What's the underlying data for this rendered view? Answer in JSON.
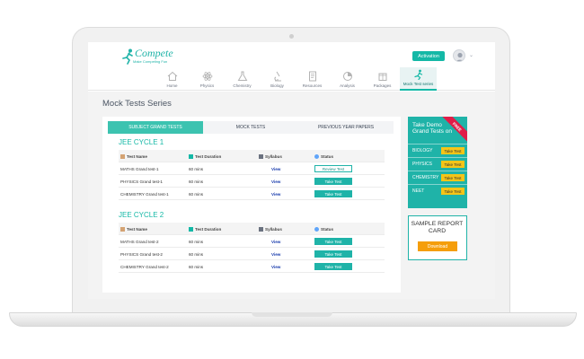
{
  "brand": {
    "logo_text": "Compete",
    "tagline": "Make Competing Fun",
    "accent": "#1fb3a8"
  },
  "header": {
    "activation_label": "Activation"
  },
  "nav": [
    {
      "label": "Home",
      "icon": "home-icon"
    },
    {
      "label": "Physics",
      "icon": "atom-icon"
    },
    {
      "label": "Chemistry",
      "icon": "flask-icon"
    },
    {
      "label": "Biology",
      "icon": "microscope-icon"
    },
    {
      "label": "Resources",
      "icon": "book-icon"
    },
    {
      "label": "Analysis",
      "icon": "pie-chart-icon"
    },
    {
      "label": "Packages",
      "icon": "box-icon"
    },
    {
      "label": "Mock Test series",
      "icon": "runner-icon",
      "active": true
    }
  ],
  "page": {
    "title": "Mock Tests Series"
  },
  "tabs": [
    {
      "label": "SUBJECT GRAND TESTS",
      "active": true
    },
    {
      "label": "MOCK TESTS"
    },
    {
      "label": "PREVIOUS YEAR PAPERS"
    }
  ],
  "columns": [
    "Test Name",
    "Test Duration",
    "Syllabus",
    "Status"
  ],
  "cycles": [
    {
      "title": "JEE CYCLE 1",
      "rows": [
        {
          "name": "MATHS Grand test-1",
          "duration": "60 mins",
          "syllabus": "View",
          "status": "Review Test"
        },
        {
          "name": "PHYSICS Grand test-1",
          "duration": "60 mins",
          "syllabus": "View",
          "status": "Take Test"
        },
        {
          "name": "CHEMISTRY Grand test-1",
          "duration": "60 mins",
          "syllabus": "View",
          "status": "Take Test"
        }
      ]
    },
    {
      "title": "JEE CYCLE 2",
      "rows": [
        {
          "name": "MATHS Grand test-2",
          "duration": "60 mins",
          "syllabus": "View",
          "status": "Take Test"
        },
        {
          "name": "PHYSICS Grand test-2",
          "duration": "60 mins",
          "syllabus": "View",
          "status": "Take Test"
        },
        {
          "name": "CHEMISTRY Grand test-2",
          "duration": "60 mins",
          "syllabus": "View",
          "status": "Take Test"
        }
      ]
    }
  ],
  "demo": {
    "title": "Take Demo Grand Tests on",
    "ribbon": "FREE",
    "items": [
      {
        "subject": "BIOLOGY",
        "button": "Take Test"
      },
      {
        "subject": "PHYSICS",
        "button": "Take Test"
      },
      {
        "subject": "CHEMISTRY",
        "button": "Take Test"
      },
      {
        "subject": "NEET",
        "button": "Take Test"
      }
    ]
  },
  "report": {
    "title": "SAMPLE REPORT CARD",
    "button": "Download"
  }
}
